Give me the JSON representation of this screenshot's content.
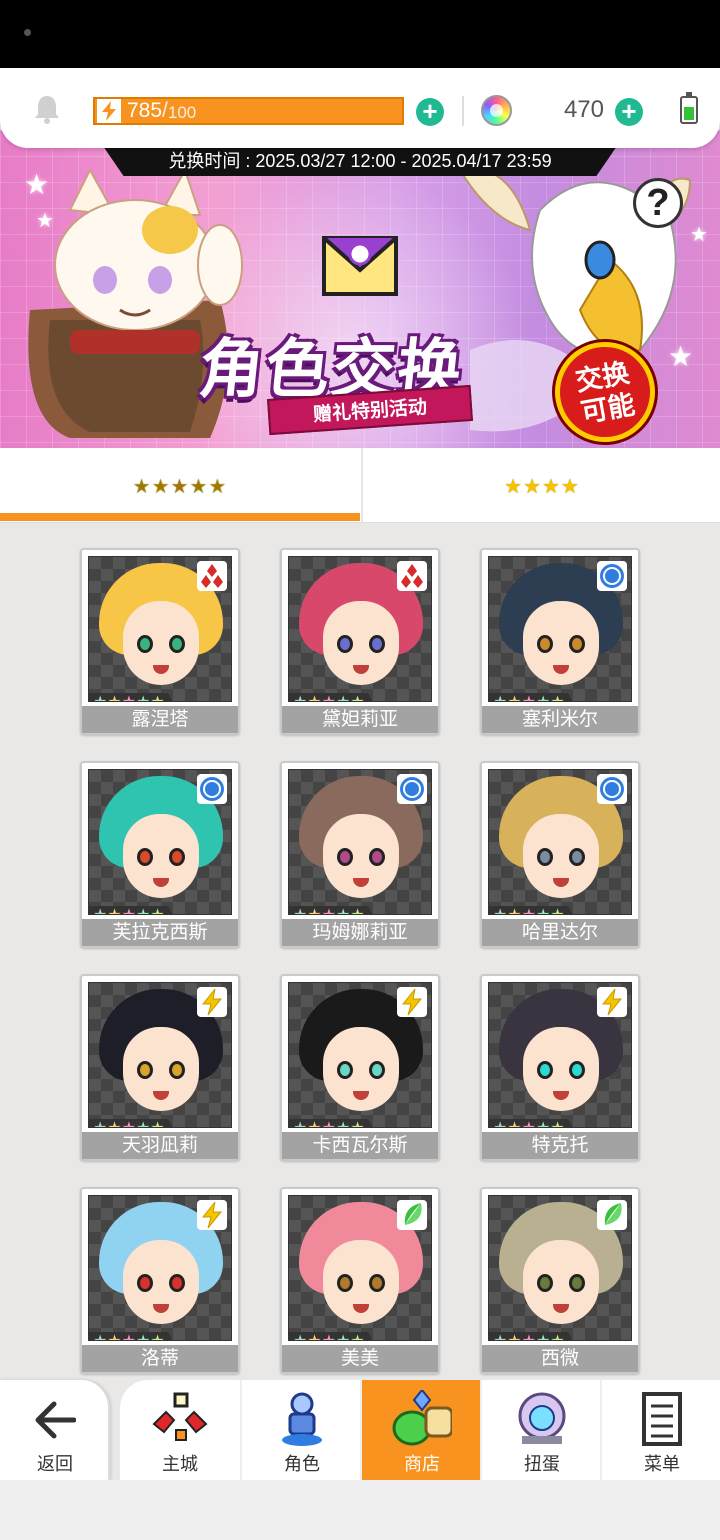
{
  "topbar": {
    "stamina_current": "785",
    "stamina_separator": "/",
    "stamina_max": "100",
    "gems": "470"
  },
  "banner": {
    "exchange_time": "兑换时间 : 2025.03/27 12:00 - 2025.04/17 23:59",
    "title": "角色交换",
    "subtitle": "赠礼特别活动",
    "badge_line1": "交换",
    "badge_line2": "可能",
    "help": "?"
  },
  "tabs": [
    {
      "label": "★★★★★",
      "active": true
    },
    {
      "label": "★★★★",
      "active": false
    }
  ],
  "cards": [
    {
      "name": "露涅塔",
      "stars": "★★★★★",
      "attribute": "fire-diamonds-icon",
      "hair": "#f7c646",
      "eye": "#36b37e"
    },
    {
      "name": "黛妲莉亚",
      "stars": "★★★★★",
      "attribute": "fire-diamonds-icon",
      "hair": "#d8486a",
      "eye": "#6a6fcf"
    },
    {
      "name": "塞利米尔",
      "stars": "★★★★★",
      "attribute": "water-circle-icon",
      "hair": "#2e3e52",
      "eye": "#c98a2a"
    },
    {
      "name": "芙拉克西斯",
      "stars": "★★★★★",
      "attribute": "water-circle-icon",
      "hair": "#2ec4b0",
      "eye": "#d94b2b"
    },
    {
      "name": "玛姆娜莉亚",
      "stars": "★★★★★",
      "attribute": "water-circle-icon",
      "hair": "#8a6a5c",
      "eye": "#b04a8a"
    },
    {
      "name": "哈里达尔",
      "stars": "★★★★★",
      "attribute": "water-circle-icon",
      "hair": "#d8b25a",
      "eye": "#7a8aa0"
    },
    {
      "name": "天羽凪莉",
      "stars": "★★★★★",
      "attribute": "lightning-icon",
      "hair": "#1e1e28",
      "eye": "#d8a42a"
    },
    {
      "name": "卡西瓦尔斯",
      "stars": "★★★★★",
      "attribute": "lightning-icon",
      "hair": "#1a1a1a",
      "eye": "#6ad8c0"
    },
    {
      "name": "特克托",
      "stars": "★★★★★",
      "attribute": "lightning-icon",
      "hair": "#3a3340",
      "eye": "#2ed8d0"
    },
    {
      "name": "洛蒂",
      "stars": "★★★★★",
      "attribute": "lightning-icon",
      "hair": "#8fd3f0",
      "eye": "#d8302a"
    },
    {
      "name": "美美",
      "stars": "★★★★★",
      "attribute": "leaf-icon",
      "hair": "#f08a9a",
      "eye": "#b07a2a"
    },
    {
      "name": "西微",
      "stars": "★★★★★",
      "attribute": "leaf-icon",
      "hair": "#b8b090",
      "eye": "#6a7a3a"
    }
  ],
  "nav": {
    "back": "返回",
    "items": [
      {
        "label": "主城",
        "icon": "castle-icon",
        "active": false
      },
      {
        "label": "角色",
        "icon": "character-icon",
        "active": false
      },
      {
        "label": "商店",
        "icon": "shop-icon",
        "active": true
      },
      {
        "label": "扭蛋",
        "icon": "gacha-icon",
        "active": false
      },
      {
        "label": "菜单",
        "icon": "menu-list-icon",
        "active": false
      }
    ]
  },
  "colors": {
    "accent": "#f7931e",
    "teal": "#1fb992",
    "fire": "#d62b2b",
    "water": "#2f7de1",
    "lightning": "#f5c400",
    "leaf": "#3cbf3c"
  }
}
